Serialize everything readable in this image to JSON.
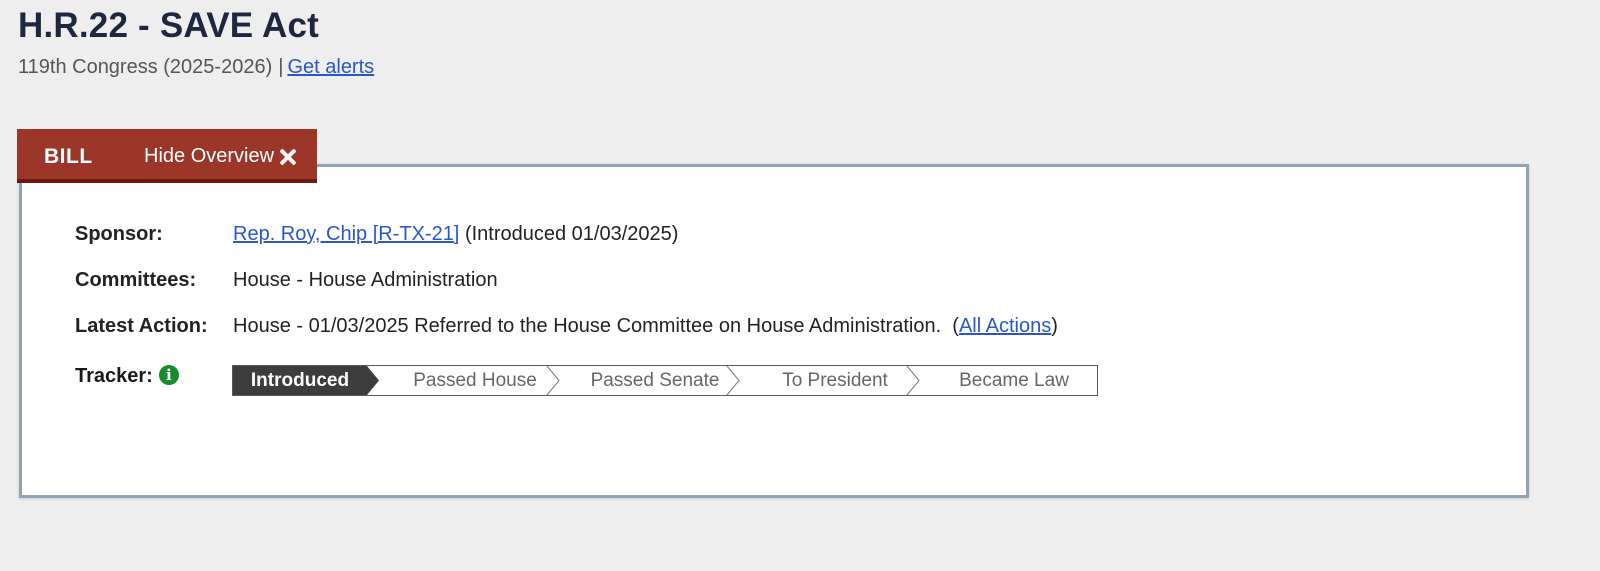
{
  "header": {
    "title": "H.R.22 - SAVE Act",
    "congress": "119th Congress (2025-2026)",
    "separator": "|",
    "alerts_link": "Get alerts"
  },
  "tabbar": {
    "type_label": "BILL",
    "hide_label": "Hide Overview"
  },
  "overview": {
    "sponsor": {
      "label": "Sponsor:",
      "name": "Rep. Roy, Chip [R-TX-21]",
      "introduced": "(Introduced 01/03/2025)"
    },
    "committees": {
      "label": "Committees:",
      "value": "House - House Administration"
    },
    "latest_action": {
      "label": "Latest Action:",
      "text": "House - 01/03/2025 Referred to the House Committee on House Administration.",
      "paren_open": "(",
      "link": "All Actions",
      "paren_close": ")"
    },
    "tracker": {
      "label": "Tracker:",
      "info_icon": "i",
      "steps": [
        "Introduced",
        "Passed House",
        "Passed Senate",
        "To President",
        "Became Law"
      ],
      "active_index": 0
    }
  },
  "colors": {
    "accent_red": "#9c3628",
    "tracker_active": "#3d3d3d",
    "link_blue": "#2b56c6",
    "info_green": "#178b2e"
  }
}
